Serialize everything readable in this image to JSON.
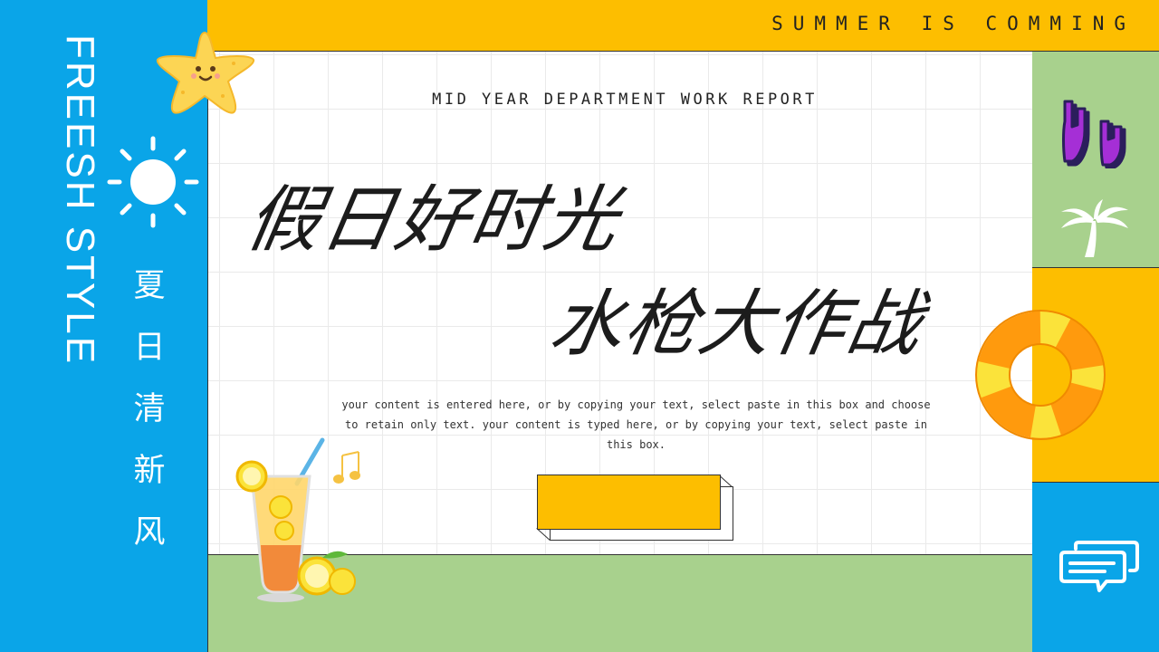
{
  "header": {
    "tagline": "SUMMER IS COMMING"
  },
  "sidebar": {
    "english_title": "FREESH STYLE",
    "chinese_title": [
      "夏",
      "日",
      "清",
      "新",
      "风"
    ]
  },
  "main": {
    "subtitle": "MID YEAR DEPARTMENT WORK REPORT",
    "title_line1": "假日好时光",
    "title_line2": "水枪大作战",
    "body": "your content is entered here, or by copying your text, select paste in this box and choose to retain only text. your content is typed here, or by copying your text, select paste in this box."
  },
  "icons": [
    "starfish-icon",
    "sun-icon",
    "rock-hands-icon",
    "palm-tree-icon",
    "swim-ring-icon",
    "chat-bubble-icon",
    "lemonade-icon",
    "music-notes-icon"
  ],
  "colors": {
    "blue": "#0aa5e8",
    "yellow": "#fdbe00",
    "green": "#a8d18d",
    "purple": "#a52fd6",
    "orange": "#ff9a0d"
  }
}
